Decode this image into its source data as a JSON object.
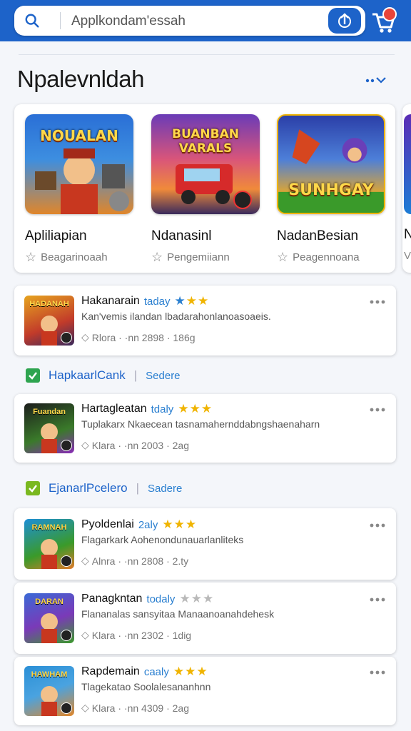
{
  "search": {
    "value": "Applkondam'essah"
  },
  "header": {
    "title": "Npalevnldah"
  },
  "featured": [
    {
      "thumb_title": "NOUALAN",
      "name": "Apliliapian",
      "subtitle": "Beagarinoaah"
    },
    {
      "thumb_title": "BUANBAN VARALS",
      "name": "Ndanasinl",
      "subtitle": "Pengemiiann"
    },
    {
      "thumb_title": "SUNHGAY",
      "name": "NadanBesian",
      "subtitle": "Peagennoana"
    }
  ],
  "featured_peek": {
    "name": "N",
    "subtitle": "V"
  },
  "apps": [
    {
      "icon_text": "HADANAH",
      "name": "Hakanarain",
      "tag": "taday",
      "stars": "★★★",
      "star_colors": [
        "#2a7fd0",
        "#f0b400",
        "#f0b400"
      ],
      "desc": "Kan'vemis ilandan lbadarahonlanoasoaeis.",
      "meta": "Rlora · ·nn 2898 · 186g"
    },
    {
      "icon_text": "Fuandan",
      "name": "Hartagleatan",
      "tag": "tdaly",
      "stars": "★★★",
      "star_colors": [
        "#f0b400",
        "#f0b400",
        "#f0b400"
      ],
      "desc": "Tuplakarx Nkaecean tasnamahernddabngshaenaharn",
      "meta": "Klara · ·nn 2003 · 2ag"
    },
    {
      "icon_text": "RAMNAH",
      "name": "Pyoldenlai",
      "tag": "2aly",
      "stars": "★★★",
      "star_colors": [
        "#f0b400",
        "#f0b400",
        "#f0b400"
      ],
      "desc": "Flagarkark Aohenondunauarlanliteks",
      "meta": "Alnra · ·nn 2808 · 2.ty"
    },
    {
      "icon_text": "DARAN",
      "name": "Panagkntan",
      "tag": "todaly",
      "stars": "★★★",
      "star_colors": [
        "#b9b9b9",
        "#b9b9b9",
        "#b9b9b9"
      ],
      "desc": "Flananalas sansyitaa Manaanoanahdehesk",
      "meta": "Klara · ·nn 2302 · 1dig"
    },
    {
      "icon_text": "HAWHAM",
      "name": "Rapdemain",
      "tag": "caaly",
      "stars": "★★★",
      "star_colors": [
        "#f0b400",
        "#f0b400",
        "#f0b400"
      ],
      "desc": "Tlagekatao Soolalesananhnn",
      "meta": "Klara · ·nn 4309 · 2ag"
    }
  ],
  "sections": [
    {
      "label": "HapkaarlCank",
      "sub": "Sedere"
    },
    {
      "label": "EjanarlPcelero",
      "sub": "Sadere"
    }
  ]
}
